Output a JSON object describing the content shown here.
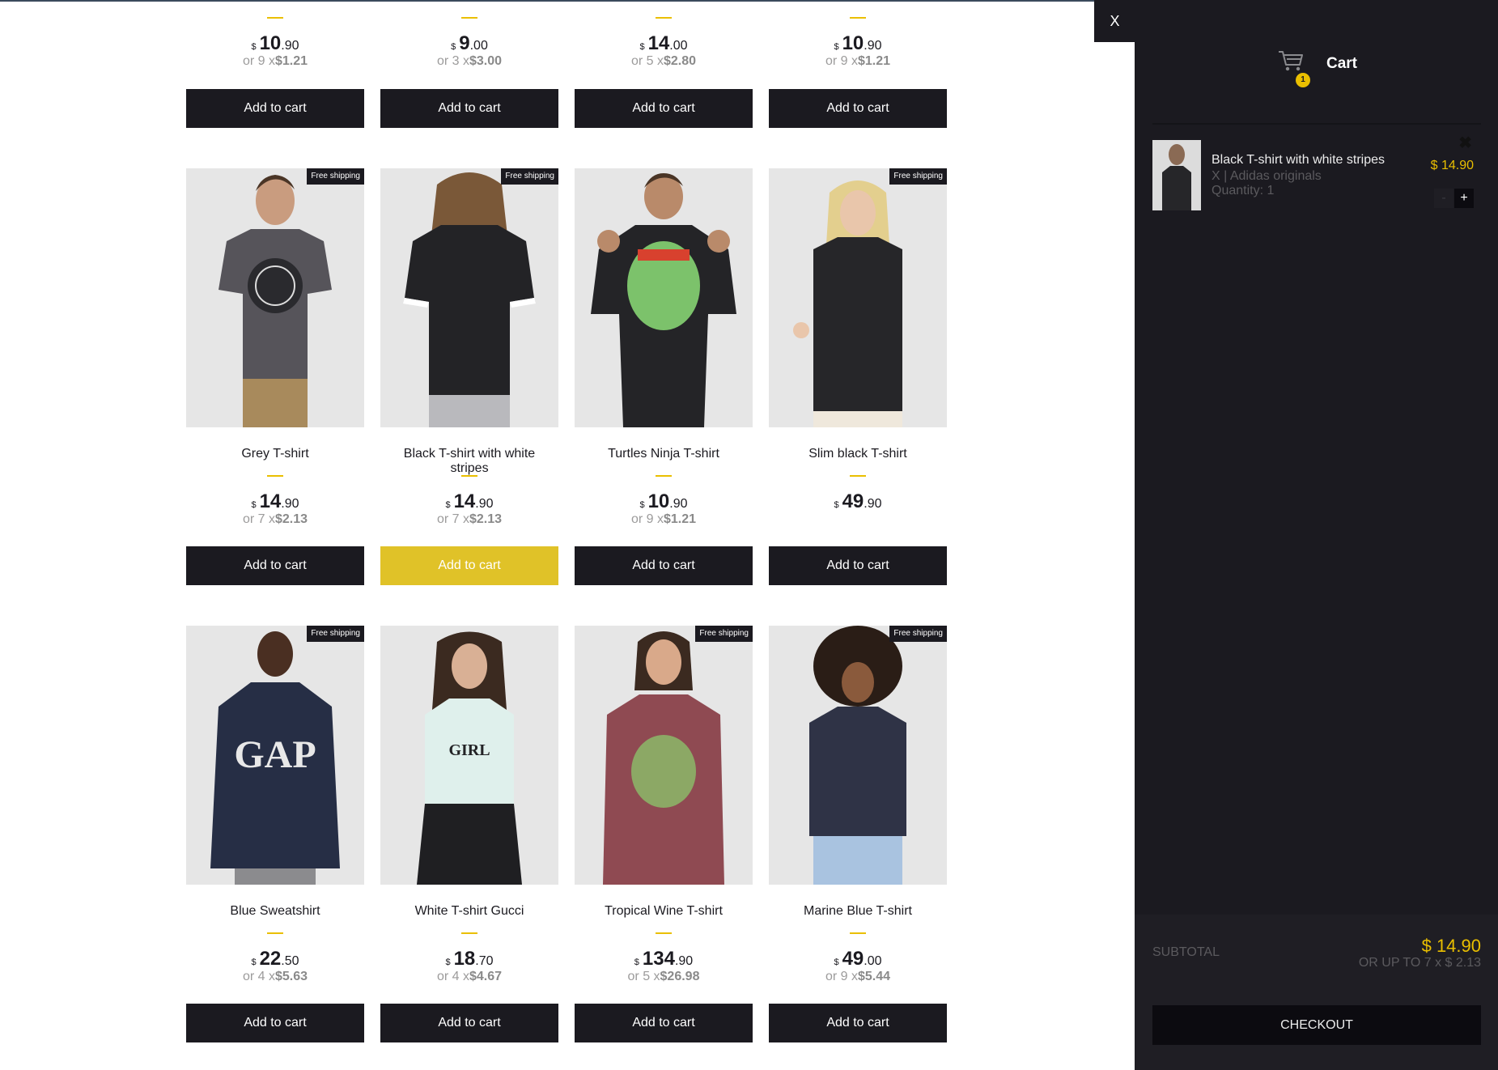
{
  "products_top": [
    {
      "price_int": "10",
      "price_dec": ".90",
      "installments_prefix": "or 9 x",
      "installments_value": "$1.21",
      "button": "Add to cart"
    },
    {
      "price_int": "9",
      "price_dec": ".00",
      "installments_prefix": "or 3 x",
      "installments_value": "$3.00",
      "button": "Add to cart"
    },
    {
      "price_int": "14",
      "price_dec": ".00",
      "installments_prefix": "or 5 x",
      "installments_value": "$2.80",
      "button": "Add to cart"
    },
    {
      "price_int": "10",
      "price_dec": ".90",
      "installments_prefix": "or 9 x",
      "installments_value": "$1.21",
      "button": "Add to cart"
    }
  ],
  "products_row2": [
    {
      "name": "Grey T-shirt",
      "free_shipping": "Free shipping",
      "price_int": "14",
      "price_dec": ".90",
      "installments_prefix": "or 7 x",
      "installments_value": "$2.13",
      "button": "Add to cart"
    },
    {
      "name": "Black T-shirt with white stripes",
      "free_shipping": "Free shipping",
      "price_int": "14",
      "price_dec": ".90",
      "installments_prefix": "or 7 x",
      "installments_value": "$2.13",
      "button": "Add to cart"
    },
    {
      "name": "Turtles Ninja T-shirt",
      "free_shipping": "",
      "price_int": "10",
      "price_dec": ".90",
      "installments_prefix": "or 9 x",
      "installments_value": "$1.21",
      "button": "Add to cart"
    },
    {
      "name": "Slim black T-shirt",
      "free_shipping": "Free shipping",
      "price_int": "49",
      "price_dec": ".90",
      "installments_prefix": "",
      "installments_value": "",
      "button": "Add to cart"
    }
  ],
  "products_row3": [
    {
      "name": "Blue Sweatshirt",
      "free_shipping": "Free shipping",
      "price_int": "22",
      "price_dec": ".50",
      "installments_prefix": "or 4 x",
      "installments_value": "$5.63",
      "button": "Add to cart"
    },
    {
      "name": "White T-shirt Gucci",
      "free_shipping": "",
      "price_int": "18",
      "price_dec": ".70",
      "installments_prefix": "or 4 x",
      "installments_value": "$4.67",
      "button": "Add to cart"
    },
    {
      "name": "Tropical Wine T-shirt",
      "free_shipping": "Free shipping",
      "price_int": "134",
      "price_dec": ".90",
      "installments_prefix": "or 5 x",
      "installments_value": "$26.98",
      "button": "Add to cart"
    },
    {
      "name": "Marine Blue T-shirt",
      "free_shipping": "Free shipping",
      "price_int": "49",
      "price_dec": ".00",
      "installments_prefix": "or 9 x",
      "installments_value": "$5.44",
      "button": "Add to cart"
    }
  ],
  "currency_symbol": "$",
  "cart": {
    "close_label": "X",
    "title": "Cart",
    "badge_count": "1",
    "item": {
      "name": "Black T-shirt with white stripes",
      "description": "X | Adidas originals",
      "quantity": "Quantity: 1",
      "price": "$ 14.90",
      "remove": "✖",
      "minus": "-",
      "plus": "+"
    },
    "subtotal_label": "SUBTOTAL",
    "subtotal_price": "$ 14.90",
    "subtotal_installments": "OR UP TO 7 x $ 2.13",
    "checkout_label": "CHECKOUT"
  },
  "colors": {
    "dark": "#1b1a20",
    "accent": "#eabf00",
    "highlight_button": "#e0c228"
  }
}
